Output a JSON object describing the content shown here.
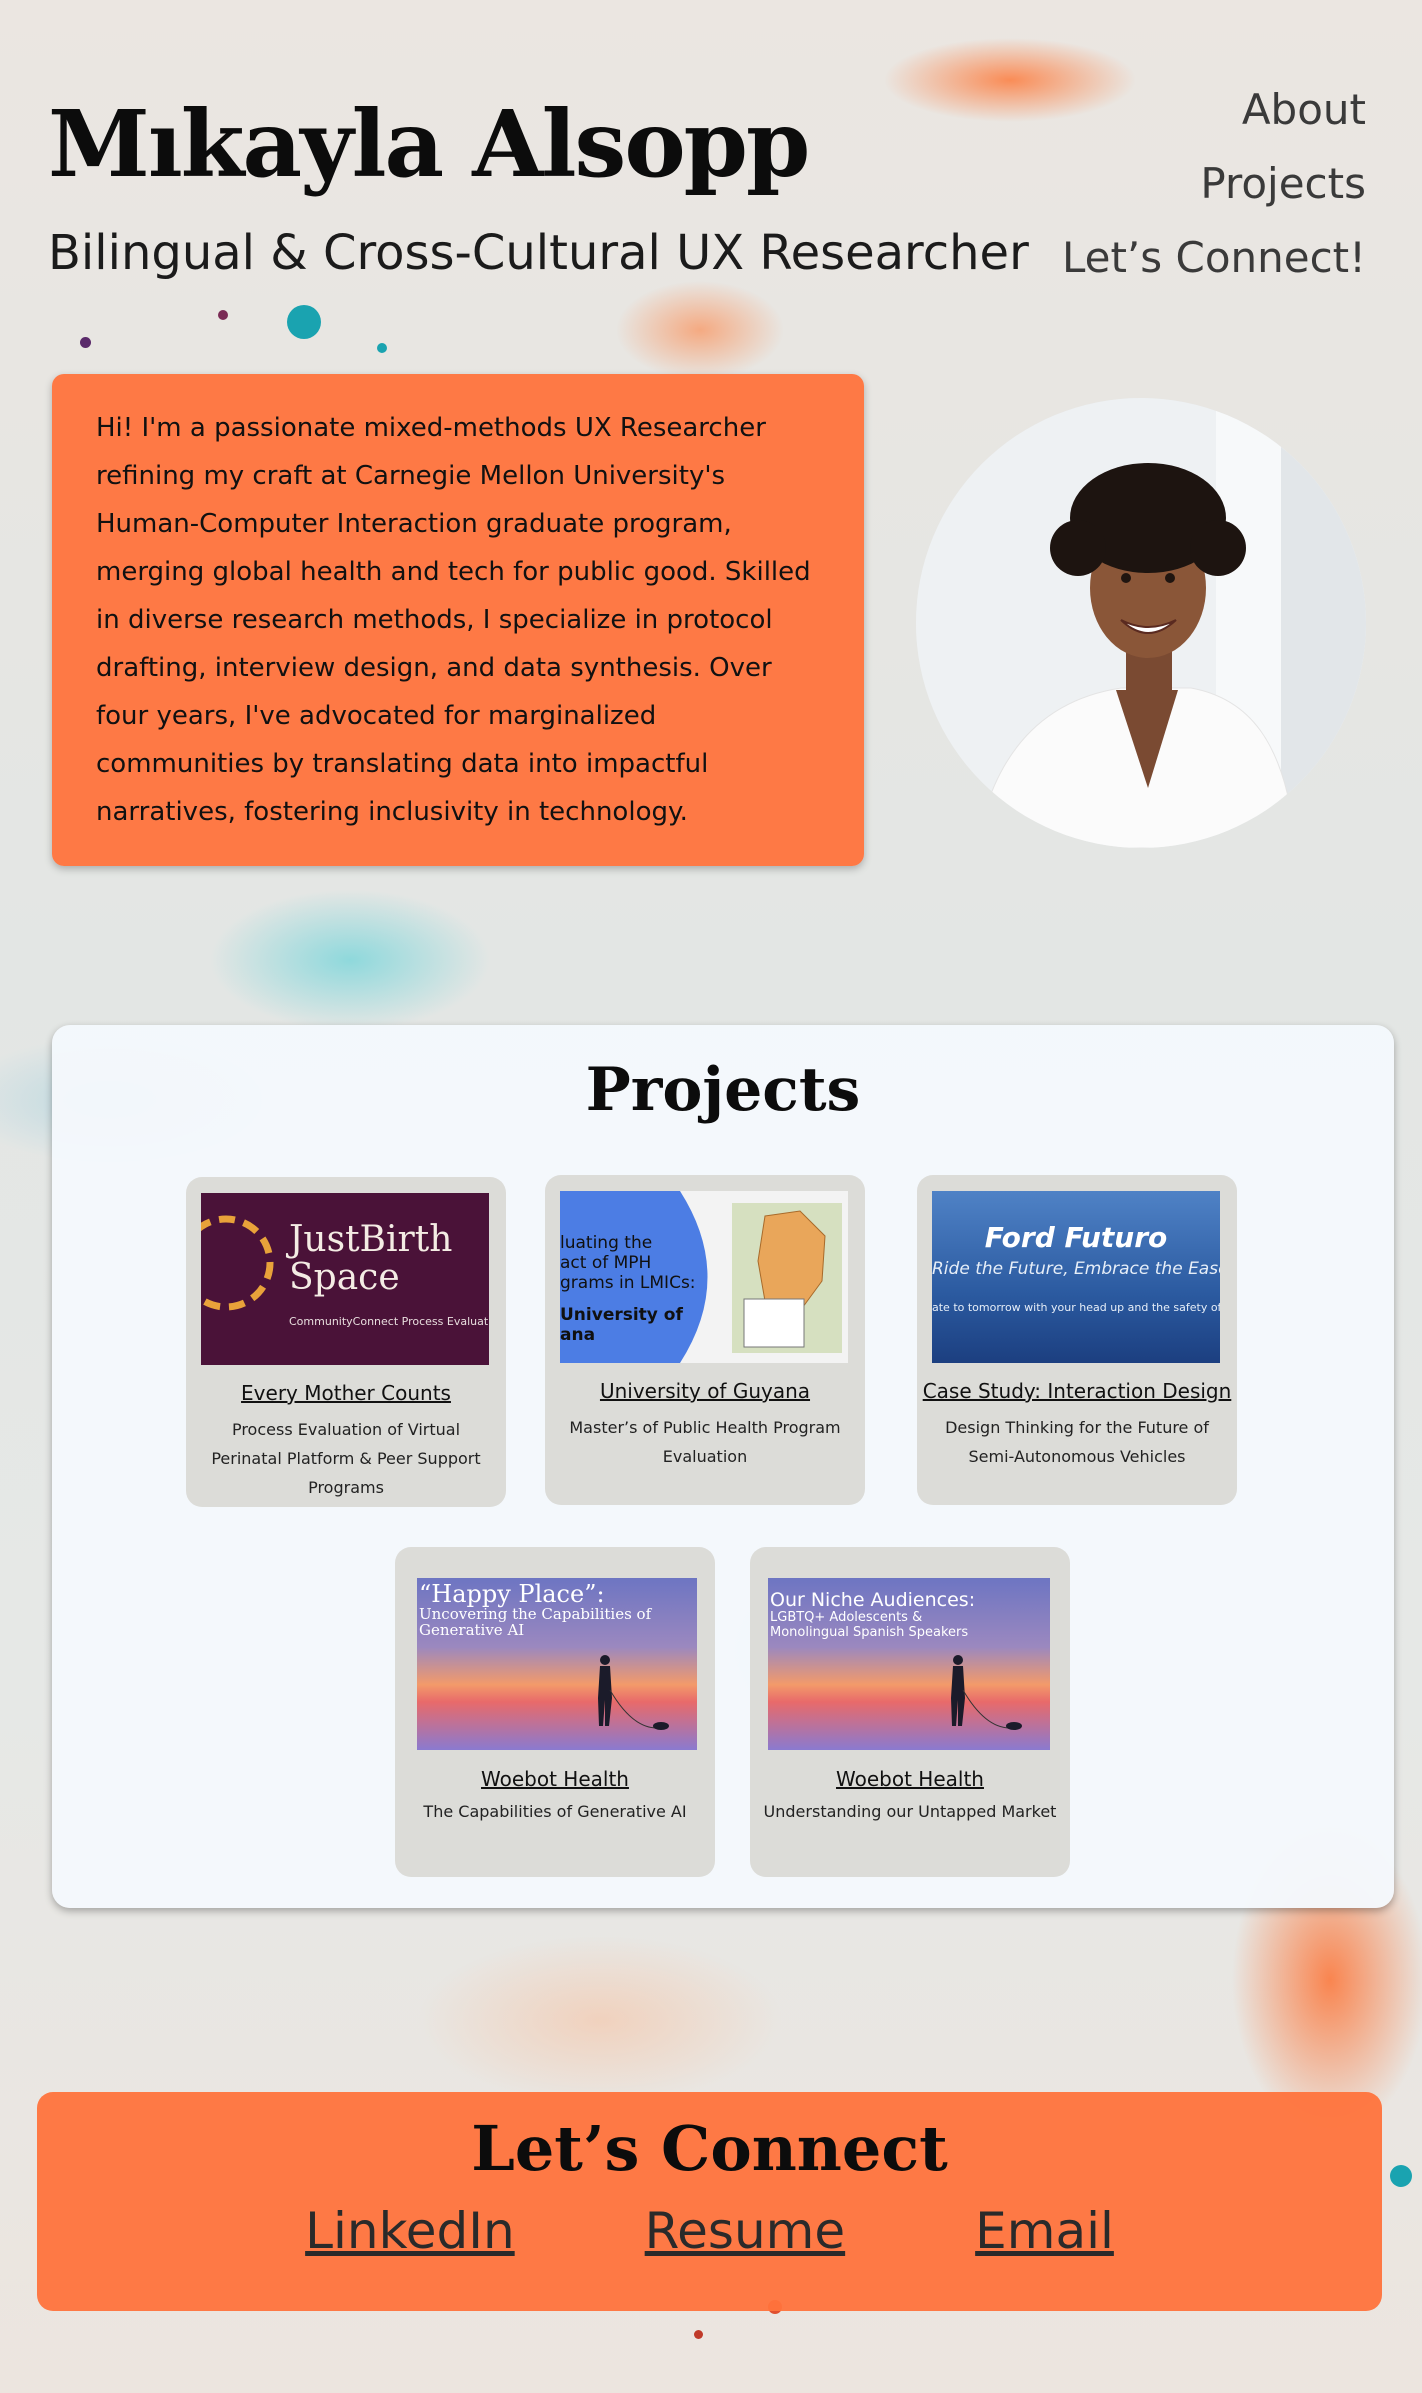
{
  "header": {
    "name": "Mıkayla Alsopp",
    "subtitle": "Bilingual & Cross-Cultural UX Researcher"
  },
  "nav": {
    "items": [
      {
        "label": "About"
      },
      {
        "label": "Projects"
      },
      {
        "label": "Let’s Connect!"
      }
    ]
  },
  "intro": {
    "text": "Hi! I'm a passionate mixed-methods UX Researcher refining my craft at Carnegie Mellon University's Human-Computer Interaction graduate program, merging global health and tech for public good. Skilled in diverse research methods, I specialize in protocol drafting, interview design, and data synthesis. Over four years, I've advocated for marginalized communities by translating data into impactful narratives, fostering inclusivity in technology."
  },
  "projects": {
    "heading": "Projects",
    "cards": [
      {
        "title": "Every Mother Counts",
        "description": "Process Evaluation of Virtual Perinatal Platform & Peer Support Programs",
        "thumb": {
          "line1": "JustBirth",
          "line2": "Space",
          "caption": "CommunityConnect Process Evaluat"
        }
      },
      {
        "title": "University of Guyana",
        "description": "Master’s of Public Health Program Evaluation",
        "thumb": {
          "l1": "luating the",
          "l2": "act of MPH",
          "l3": "grams in LMICs:",
          "l4": "University of",
          "l5": "ana"
        }
      },
      {
        "title": "Case Study: Interaction Design",
        "description": "Design Thinking for the Future of Semi-Autonomous Vehicles",
        "thumb": {
          "brand": "Ford Futuro",
          "tagline": "Ride the Future, Embrace the Ease",
          "small": "ate to tomorrow with your head up and the safety of guided aut"
        }
      },
      {
        "title": "Woebot Health",
        "description": "The Capabilities of Generative AI",
        "thumb": {
          "t1": "“Happy Place”:",
          "t2": "Uncovering the Capabilities of",
          "t3": "Generative AI"
        }
      },
      {
        "title": "Woebot Health",
        "description": "Understanding our Untapped Market",
        "thumb": {
          "t1": "Our Niche Audiences:",
          "t2": "LGBTQ+ Adolescents &",
          "t3": "Monolingual Spanish Speakers"
        }
      }
    ]
  },
  "connect": {
    "heading": "Let’s Connect",
    "links": [
      {
        "label": "LinkedIn"
      },
      {
        "label": "Resume"
      },
      {
        "label": "Email"
      }
    ]
  },
  "colors": {
    "accent": "#ff733c",
    "panel": "#f4f8fc",
    "card": "#dcdcd8"
  }
}
